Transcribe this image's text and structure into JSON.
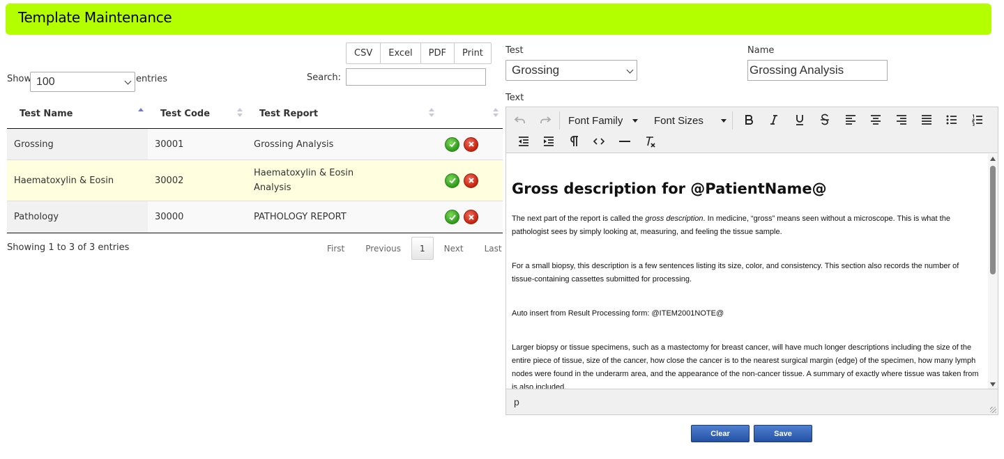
{
  "header": {
    "title": "Template Maintenance"
  },
  "export_buttons": {
    "csv": "CSV",
    "excel": "Excel",
    "pdf": "PDF",
    "print": "Print"
  },
  "length_control": {
    "show_label": "Show",
    "value": "100",
    "entries_label": "entries"
  },
  "search": {
    "label": "Search:",
    "value": ""
  },
  "table": {
    "headers": {
      "name": "Test Name",
      "code": "Test Code",
      "report": "Test Report"
    },
    "rows": [
      {
        "name": "Grossing",
        "code": "30001",
        "report": "Grossing Analysis"
      },
      {
        "name": "Haematoxylin & Eosin",
        "code": "30002",
        "report": "Haematoxylin & Eosin Analysis"
      },
      {
        "name": "Pathology",
        "code": "30000",
        "report": "PATHOLOGY REPORT"
      }
    ],
    "info": "Showing 1 to 3 of 3 entries"
  },
  "pagination": {
    "first": "First",
    "previous": "Previous",
    "current": "1",
    "next": "Next",
    "last": "Last"
  },
  "form": {
    "test_label": "Test",
    "test_value": "Grossing",
    "name_label": "Name",
    "name_value": "Grossing Analysis",
    "text_label": "Text"
  },
  "editor": {
    "font_family": "Font Family",
    "font_sizes": "Font Sizes",
    "heading": "Gross description for @PatientName@",
    "p1_before": "The next part of the report is called the ",
    "p1_em": "gross description",
    "p1_after": ". In medicine, “gross” means seen without a microscope. This is what the pathologist sees by simply looking at, measuring, and feeling the tissue sample.",
    "p2": "For a small biopsy, this description is a few sentences listing its size, color, and consistency. This section also records the number of tissue-containing cassettes submitted for processing.",
    "p3": "Auto insert from Result Processing form: @ITEM2001NOTE@",
    "p4": "Larger biopsy or tissue specimens, such as a mastectomy for breast cancer, will have much longer descriptions including the size of the entire piece of tissue, size of the cancer, how close the cancer is to the nearest surgical margin (edge) of the specimen, how many lymph nodes were found in the underarm area, and the appearance of the non-cancer tissue. A summary of exactly where tissue was taken from is also included.",
    "status_path": "p"
  },
  "actions": {
    "clear": "Clear",
    "save": "Save"
  },
  "colors": {
    "title_bar": "#b3ff00",
    "primary_button": "#2451a3",
    "row_highlight": "#ffffe0",
    "ok": "#2e9a1c",
    "delete": "#c5220e"
  }
}
